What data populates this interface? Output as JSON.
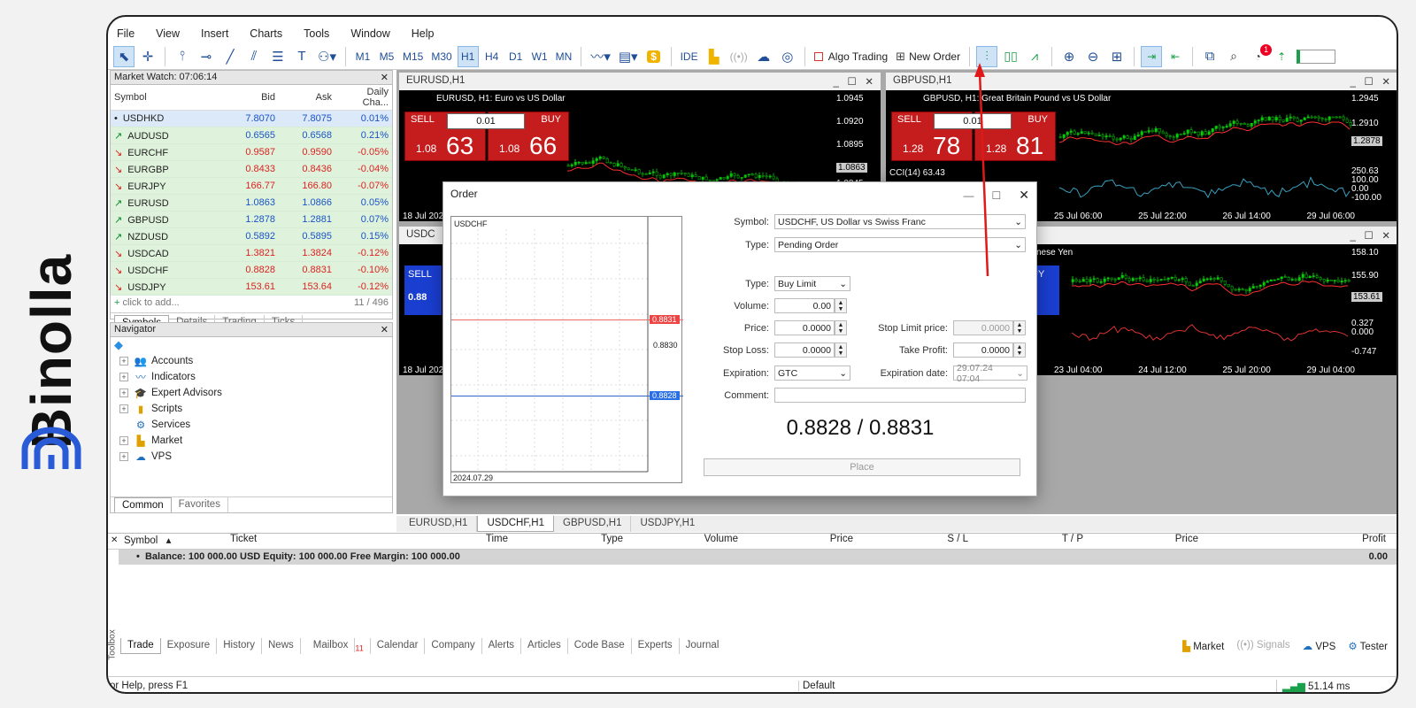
{
  "brand": {
    "name": "Binolla"
  },
  "menu": [
    "File",
    "View",
    "Insert",
    "Charts",
    "Tools",
    "Window",
    "Help"
  ],
  "toolbar": {
    "timeframes": [
      "M1",
      "M5",
      "M15",
      "M30",
      "H1",
      "H4",
      "D1",
      "W1",
      "MN"
    ],
    "active_timeframe": "H1",
    "ide": "IDE",
    "algo": "Algo Trading",
    "new_order": "New Order",
    "notif": "1"
  },
  "market_watch": {
    "title": "Market Watch: 07:06:14",
    "headers": [
      "Symbol",
      "Bid",
      "Ask",
      "Daily Cha..."
    ],
    "rows": [
      {
        "symbol": "USDHKD",
        "bid": "7.8070",
        "ask": "7.8075",
        "chg": "0.01%"
      },
      {
        "symbol": "AUDUSD",
        "bid": "0.6565",
        "ask": "0.6568",
        "chg": "0.21%"
      },
      {
        "symbol": "EURCHF",
        "bid": "0.9587",
        "ask": "0.9590",
        "chg": "-0.05%"
      },
      {
        "symbol": "EURGBP",
        "bid": "0.8433",
        "ask": "0.8436",
        "chg": "-0.04%"
      },
      {
        "symbol": "EURJPY",
        "bid": "166.77",
        "ask": "166.80",
        "chg": "-0.07%"
      },
      {
        "symbol": "EURUSD",
        "bid": "1.0863",
        "ask": "1.0866",
        "chg": "0.05%"
      },
      {
        "symbol": "GBPUSD",
        "bid": "1.2878",
        "ask": "1.2881",
        "chg": "0.07%"
      },
      {
        "symbol": "NZDUSD",
        "bid": "0.5892",
        "ask": "0.5895",
        "chg": "0.15%"
      },
      {
        "symbol": "USDCAD",
        "bid": "1.3821",
        "ask": "1.3824",
        "chg": "-0.12%"
      },
      {
        "symbol": "USDCHF",
        "bid": "0.8828",
        "ask": "0.8831",
        "chg": "-0.10%"
      },
      {
        "symbol": "USDJPY",
        "bid": "153.61",
        "ask": "153.64",
        "chg": "-0.12%"
      }
    ],
    "add_label": "click to add...",
    "count": "11 / 496",
    "tabs": [
      "Symbols",
      "Details",
      "Trading",
      "Ticks"
    ]
  },
  "navigator": {
    "title": "Navigator",
    "items": [
      "Accounts",
      "Indicators",
      "Expert Advisors",
      "Scripts",
      "Services",
      "Market",
      "VPS"
    ],
    "tabs": [
      "Common",
      "Favorites"
    ]
  },
  "charts": {
    "eurusd": {
      "tab": "EURUSD,H1",
      "label": "EURUSD, H1:  Euro vs US Dollar",
      "sell": "SELL",
      "buy": "BUY",
      "lot": "0.01",
      "bid_small": "1.08",
      "bid_big": "63",
      "ask_small": "1.08",
      "ask_big": "66",
      "prices": [
        "1.0945",
        "1.0920",
        "1.0895",
        "1.0863",
        "1.0845"
      ],
      "date": "18 Jul 2024"
    },
    "gbpusd": {
      "tab": "GBPUSD,H1",
      "label": "GBPUSD, H1:  Great Britain Pound vs US Dollar",
      "sell": "SELL",
      "buy": "BUY",
      "lot": "0.01",
      "bid_small": "1.28",
      "bid_big": "78",
      "ask_small": "1.28",
      "ask_big": "81",
      "prices": [
        "1.2945",
        "1.2910",
        "1.2878"
      ],
      "cci": "CCI(14) 63.43",
      "cci_levels": [
        "250.63",
        "100.00",
        "0.00",
        "-100.00"
      ],
      "dates": [
        "25 Jul 06:00",
        "25 Jul 22:00",
        "26 Jul 14:00",
        "29 Jul 06:00"
      ]
    },
    "usdjpy": {
      "tab": "USDJPY,H1",
      "label": "nese Yen",
      "buy": "UY",
      "prices": [
        "158.10",
        "155.90",
        "153.61"
      ],
      "osc": [
        "0.327",
        "0.000",
        "-0.747"
      ],
      "dates": [
        "23 Jul 04:00",
        "24 Jul 12:00",
        "25 Jul 20:00",
        "29 Jul 04:00"
      ]
    },
    "usdchf": {
      "tab": "USDCHF,H1",
      "label": "USDC",
      "sell": "SELL",
      "bid_small": "0.88",
      "date": "18 Jul 2024"
    }
  },
  "order": {
    "title": "Order",
    "preview": {
      "symbol": "USDCHF",
      "ask_line": "0.8831",
      "mid": "0.8830",
      "bid_line": "0.8828",
      "date": "2024.07.29"
    },
    "symbol_label": "Symbol:",
    "symbol": "USDCHF, US Dollar vs Swiss Franc",
    "type_label": "Type:",
    "type": "Pending Order",
    "type2_label": "Type:",
    "type2": "Buy Limit",
    "volume_label": "Volume:",
    "volume": "0.00",
    "price_label": "Price:",
    "price": "0.0000",
    "stop_limit_label": "Stop Limit price:",
    "stop_limit": "0.0000",
    "sl_label": "Stop Loss:",
    "sl": "0.0000",
    "tp_label": "Take Profit:",
    "tp": "0.0000",
    "exp_label": "Expiration:",
    "exp": "GTC",
    "exp_date_label": "Expiration date:",
    "exp_date": "29.07.24 07:04",
    "comment_label": "Comment:",
    "quote": "0.8828 / 0.8831",
    "place": "Place"
  },
  "toolbox": {
    "headers": [
      "Symbol",
      "Ticket",
      "Time",
      "Type",
      "Volume",
      "Price",
      "S / L",
      "T / P",
      "Price",
      "Profit"
    ],
    "balance": "Balance: 100 000.00 USD  Equity: 100 000.00  Free Margin: 100 000.00",
    "profit": "0.00",
    "tabs": [
      "Trade",
      "Exposure",
      "History",
      "News",
      "Mailbox",
      "Calendar",
      "Company",
      "Alerts",
      "Articles",
      "Code Base",
      "Experts",
      "Journal"
    ],
    "mailbox_count": "11",
    "right": [
      "Market",
      "Signals",
      "VPS",
      "Tester"
    ],
    "side_label": "Toolbox"
  },
  "status": {
    "help": "or Help, press F1",
    "profile": "Default",
    "ping": "51.14 ms"
  },
  "colors": {
    "bull": "#00d000",
    "bear": "#ff3030",
    "sell": "#c51d1d",
    "accent": "#1f4e96"
  }
}
